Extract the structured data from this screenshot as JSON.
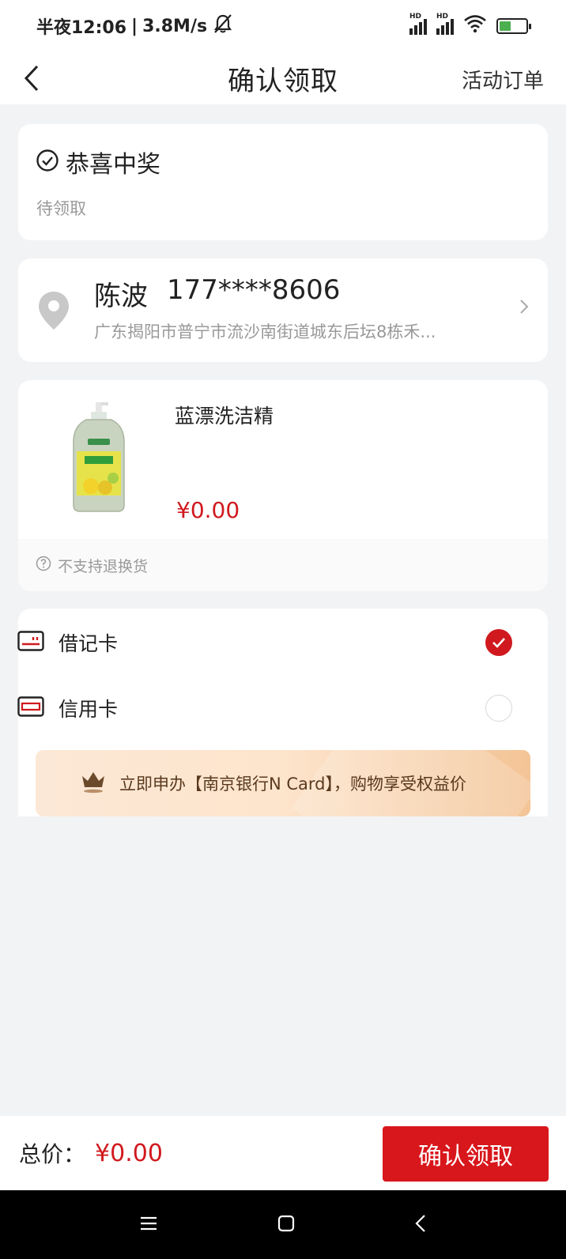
{
  "status_bar": {
    "time": "半夜12:06",
    "separator": "|",
    "speed": "3.8M/s",
    "signal_label_1": "HD",
    "signal_label_2": "HD"
  },
  "nav": {
    "title": "确认领取",
    "right_link": "活动订单"
  },
  "order_status": {
    "title": "恭喜中奖",
    "state": "待领取"
  },
  "address": {
    "name": "陈波",
    "phone": "177****8606",
    "detail": "广东揭阳市普宁市流沙南街道城东后坛8栋禾..."
  },
  "product": {
    "name": "蓝漂洗洁精",
    "price": "¥0.00",
    "return_policy": "不支持退换货"
  },
  "payment": {
    "options": [
      {
        "label": "借记卡",
        "selected": true
      },
      {
        "label": "信用卡",
        "selected": false
      }
    ],
    "promo": "立即申办【南京银行N Card】，购物享受权益价"
  },
  "footer": {
    "total_label": "总价：",
    "total_price": "¥0.00",
    "confirm_label": "确认领取"
  },
  "colors": {
    "accent": "#d0191e",
    "background": "#f2f3f5"
  }
}
